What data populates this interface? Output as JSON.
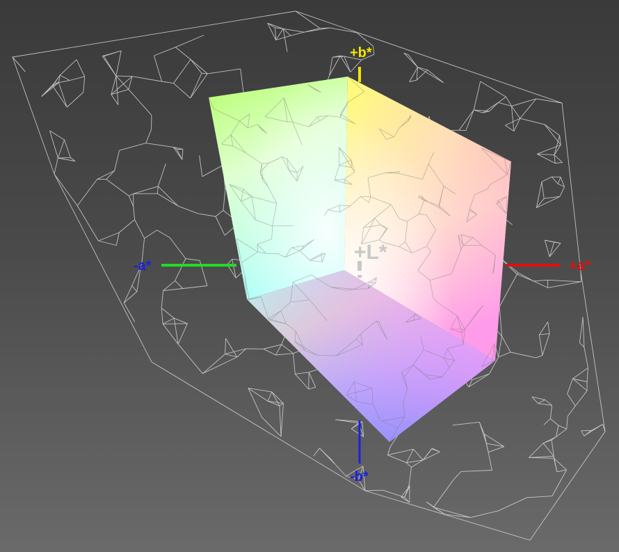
{
  "scene": {
    "type": "color-gamut-3d-view",
    "background_top": "#3a3a3a",
    "background_bottom": "#6a6a6a",
    "wireframe_color": "#d8d8d8"
  },
  "axes": {
    "plus_b": {
      "text": "+b*",
      "color": "#f2e600"
    },
    "minus_b": {
      "text": "-b*",
      "color": "#1a22e0"
    },
    "plus_a": {
      "text": "+a*",
      "color": "#e01010"
    },
    "minus_a": {
      "text": "-a*",
      "color": "#1a22e0"
    },
    "plus_L": {
      "text": "+L*",
      "color": "#c8c8c8"
    },
    "minus_a_line_color": "#22dd22"
  }
}
